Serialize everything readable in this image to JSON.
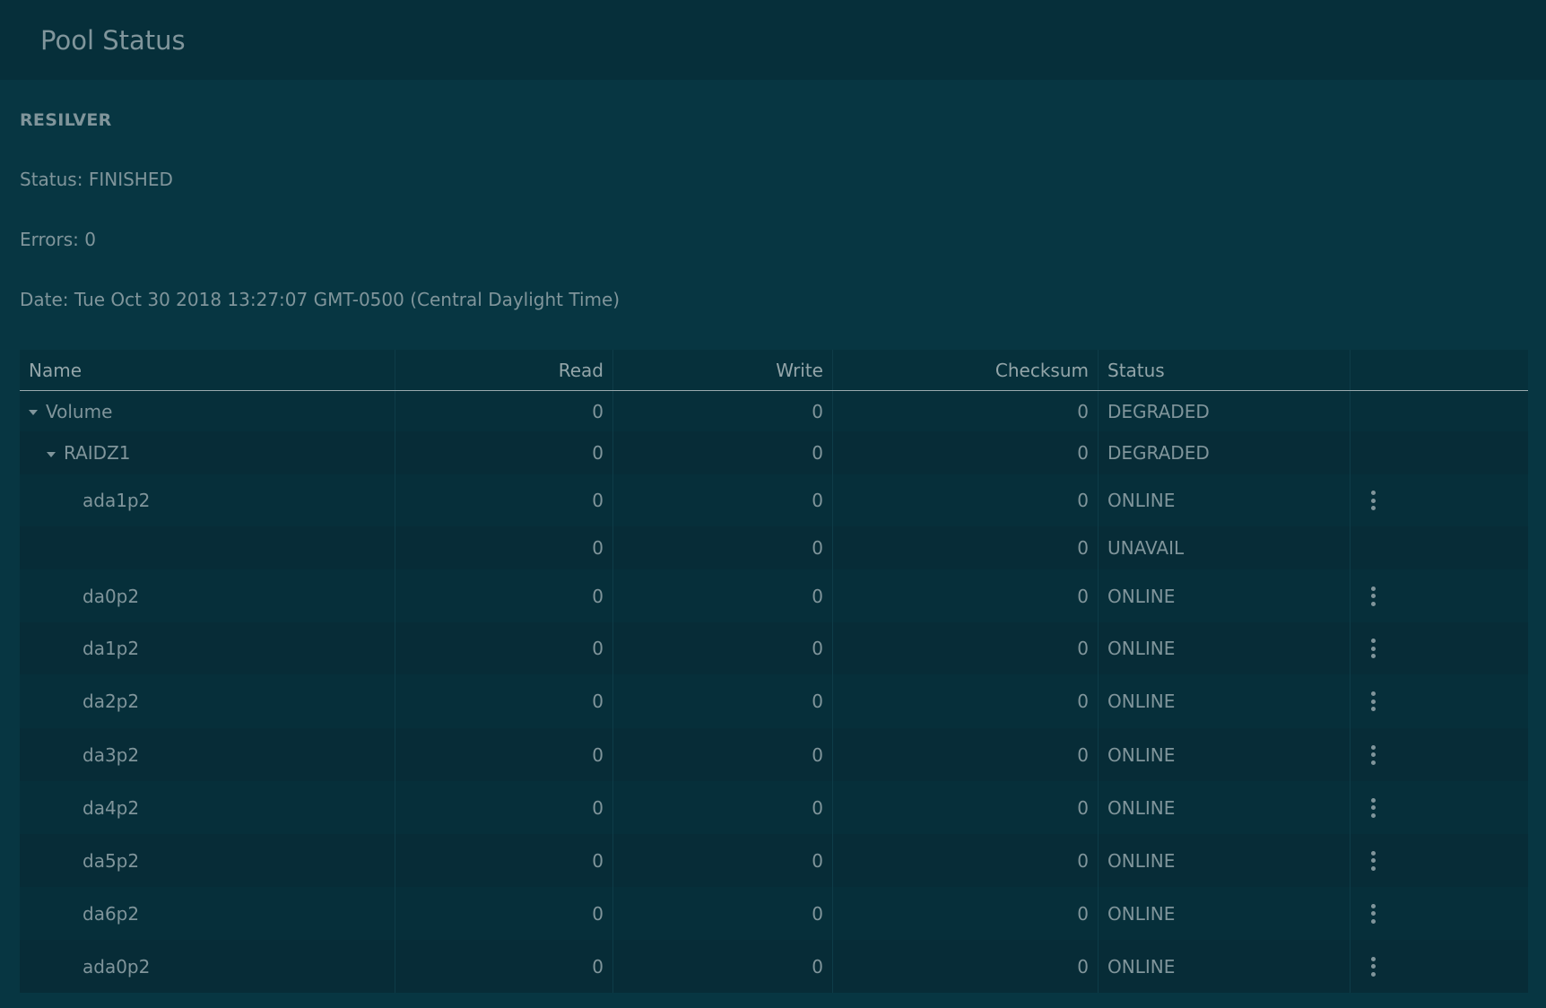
{
  "header": {
    "title": "Pool Status"
  },
  "scan": {
    "heading": "RESILVER",
    "status": "Status: FINISHED",
    "errors": "Errors: 0",
    "date": "Date: Tue Oct 30 2018 13:27:07 GMT-0500 (Central Daylight Time)"
  },
  "table": {
    "columns": [
      "Name",
      "Read",
      "Write",
      "Checksum",
      "Status",
      ""
    ],
    "rows": [
      {
        "name": "Volume",
        "read": "0",
        "write": "0",
        "checksum": "0",
        "status": "DEGRADED"
      },
      {
        "name": "RAIDZ1",
        "read": "0",
        "write": "0",
        "checksum": "0",
        "status": "DEGRADED"
      },
      {
        "name": "ada1p2",
        "read": "0",
        "write": "0",
        "checksum": "0",
        "status": "ONLINE"
      },
      {
        "name": "",
        "read": "0",
        "write": "0",
        "checksum": "0",
        "status": "UNAVAIL"
      },
      {
        "name": "da0p2",
        "read": "0",
        "write": "0",
        "checksum": "0",
        "status": "ONLINE"
      },
      {
        "name": "da1p2",
        "read": "0",
        "write": "0",
        "checksum": "0",
        "status": "ONLINE"
      },
      {
        "name": "da2p2",
        "read": "0",
        "write": "0",
        "checksum": "0",
        "status": "ONLINE"
      },
      {
        "name": "da3p2",
        "read": "0",
        "write": "0",
        "checksum": "0",
        "status": "ONLINE"
      },
      {
        "name": "da4p2",
        "read": "0",
        "write": "0",
        "checksum": "0",
        "status": "ONLINE"
      },
      {
        "name": "da5p2",
        "read": "0",
        "write": "0",
        "checksum": "0",
        "status": "ONLINE"
      },
      {
        "name": "da6p2",
        "read": "0",
        "write": "0",
        "checksum": "0",
        "status": "ONLINE"
      },
      {
        "name": "ada0p2",
        "read": "0",
        "write": "0",
        "checksum": "0",
        "status": "ONLINE"
      }
    ]
  },
  "icons": {
    "expand": "caret-down-icon",
    "menu": "more-vertical-icon"
  }
}
